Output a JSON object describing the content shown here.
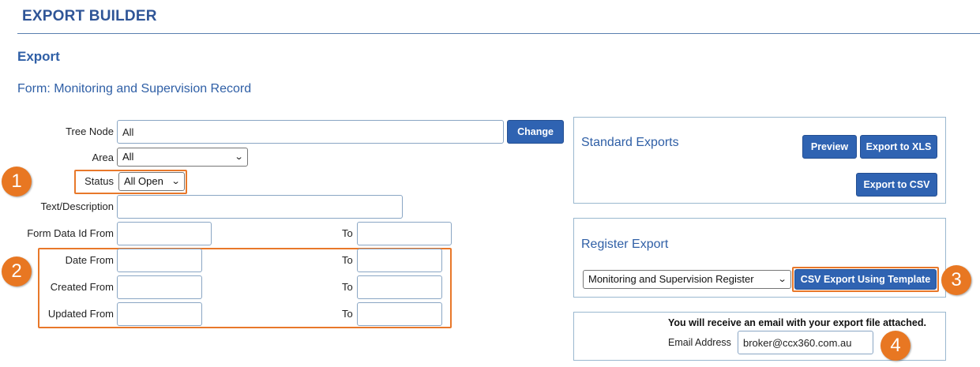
{
  "header": {
    "title": "EXPORT BUILDER"
  },
  "section": {
    "title": "Export",
    "form_name": "Form: Monitoring and Supervision Record"
  },
  "filters": {
    "tree_node": {
      "label": "Tree Node",
      "value": "All",
      "change_label": "Change"
    },
    "area": {
      "label": "Area",
      "value": "All"
    },
    "status": {
      "label": "Status",
      "value": "All Open"
    },
    "text_description": {
      "label": "Text/Description",
      "value": ""
    },
    "form_data_id": {
      "label": "Form Data Id From",
      "to_label": "To",
      "from": "",
      "to": ""
    },
    "date": {
      "label": "Date From",
      "to_label": "To",
      "from": "",
      "to": ""
    },
    "created": {
      "label": "Created From",
      "to_label": "To",
      "from": "",
      "to": ""
    },
    "updated": {
      "label": "Updated From",
      "to_label": "To",
      "from": "",
      "to": ""
    }
  },
  "standard_exports": {
    "title": "Standard Exports",
    "preview_label": "Preview",
    "xls_label": "Export to XLS",
    "csv_label": "Export to CSV"
  },
  "register_export": {
    "title": "Register Export",
    "selected_register": "Monitoring and Supervision Register",
    "csv_template_label": "CSV Export Using Template"
  },
  "email": {
    "notice": "You will receive an email with your export file attached.",
    "label": "Email Address",
    "value": "broker@ccx360.com.au"
  },
  "callouts": [
    "1",
    "2",
    "3",
    "4"
  ],
  "colors": {
    "accent": "#2f63b2",
    "callout": "#e87722",
    "heading": "#2f5597"
  }
}
